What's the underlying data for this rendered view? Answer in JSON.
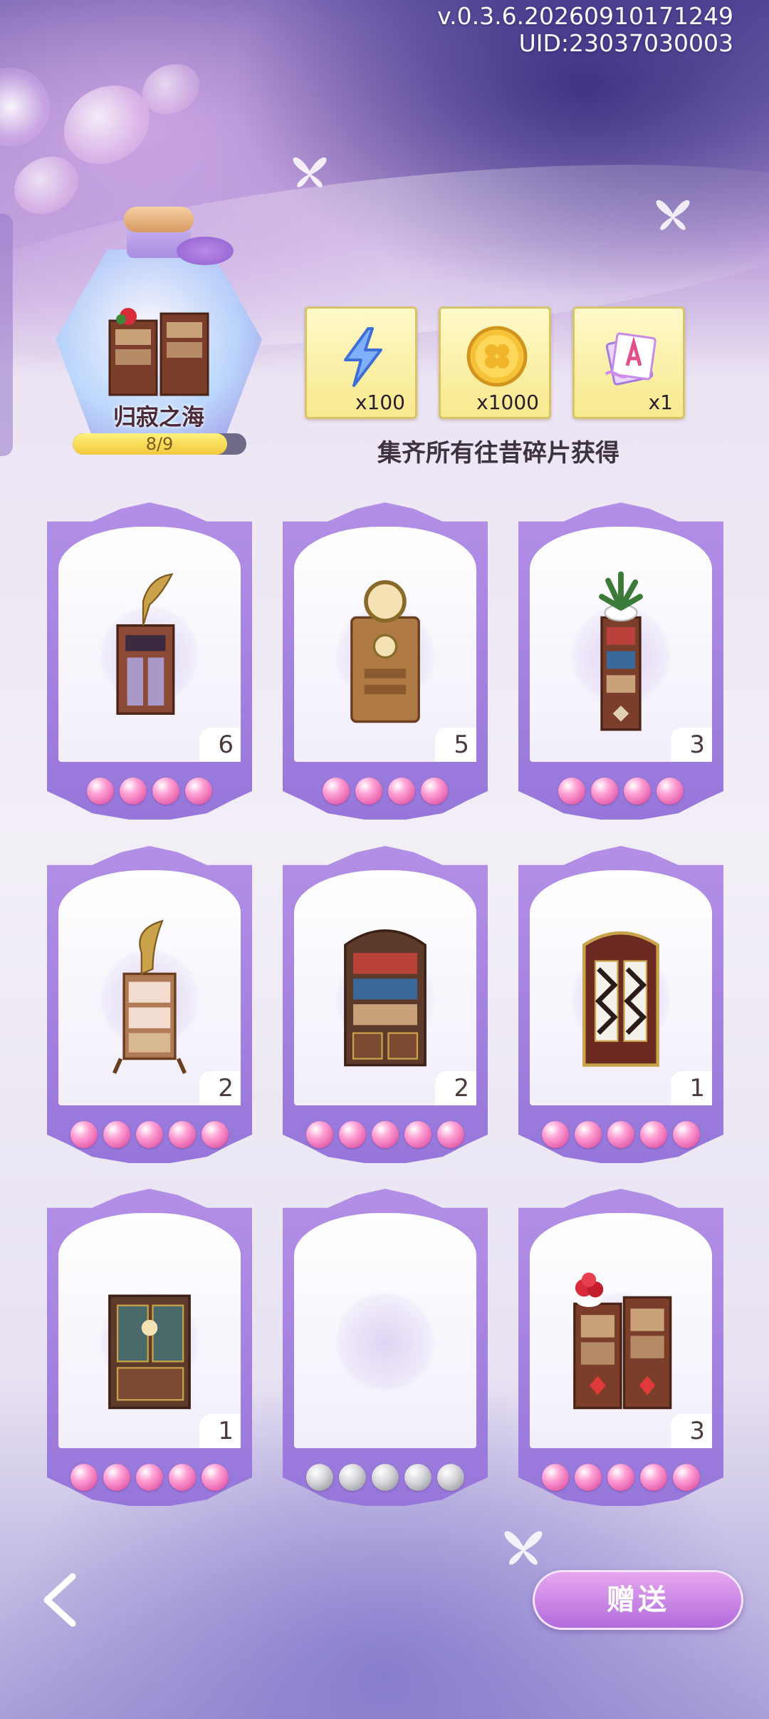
{
  "header": {
    "version": "v.0.3.6.20260910171249",
    "uid": "UID:23037030003"
  },
  "collection": {
    "name": "归寂之海",
    "progress_text": "8/9",
    "progress_fraction": 0.889
  },
  "rewards": {
    "items": [
      {
        "icon": "lightning-energy-icon",
        "qty": "x100"
      },
      {
        "icon": "gold-clover-coin-icon",
        "qty": "x1000"
      },
      {
        "icon": "letter-card-icon",
        "qty": "x1"
      }
    ],
    "caption": "集齐所有往昔碎片获得"
  },
  "cards": [
    {
      "item": "gramophone-cabinet",
      "count": "6",
      "gems_filled": 4,
      "gems_total": 4
    },
    {
      "item": "clock-cabinet",
      "count": "5",
      "gems_filled": 4,
      "gems_total": 4
    },
    {
      "item": "narrow-bookshelf-with-plant",
      "count": "3",
      "gems_filled": 4,
      "gems_total": 4
    },
    {
      "item": "gramophone-display-shelf",
      "count": "2",
      "gems_filled": 5,
      "gems_total": 5
    },
    {
      "item": "tall-bookcase",
      "count": "2",
      "gems_filled": 5,
      "gems_total": 5
    },
    {
      "item": "ornate-wardrobe",
      "count": "1",
      "gems_filled": 5,
      "gems_total": 5
    },
    {
      "item": "glass-display-cabinet",
      "count": "1",
      "gems_filled": 5,
      "gems_total": 5
    },
    {
      "item": "empty-slot",
      "count": "",
      "gems_filled": 0,
      "gems_total": 5
    },
    {
      "item": "double-bookcase-with-roses",
      "count": "3",
      "gems_filled": 5,
      "gems_total": 5
    }
  ],
  "footer": {
    "gift_label": "赠送",
    "back_icon": "chevron-left-icon"
  },
  "colors": {
    "card_frame": "#9676da",
    "gem_filled": "#e05aa8",
    "gem_empty": "#9c9ca8",
    "reward_bg": "#f7e98d",
    "gift_button": "#b06bdc"
  }
}
